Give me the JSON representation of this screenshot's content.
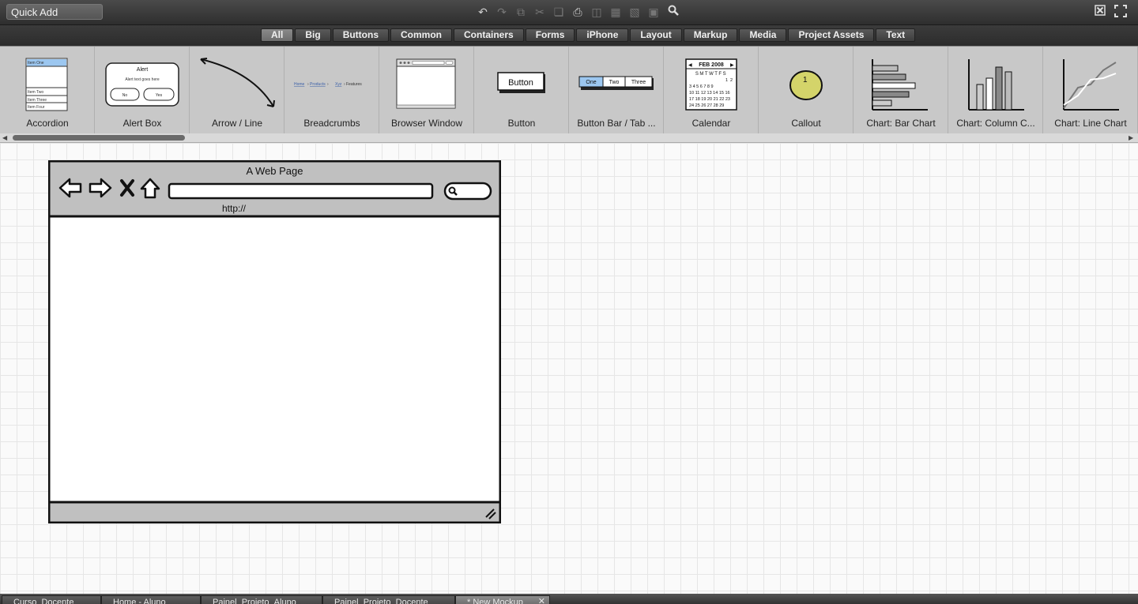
{
  "toolbar": {
    "quick_add_value": "Quick Add",
    "icons": [
      "undo-icon",
      "redo-icon",
      "duplicate-icon",
      "cut-icon",
      "copy-icon",
      "paste-icon",
      "delete-icon",
      "group-icon",
      "ungroup-icon",
      "lock-icon",
      "search-icon"
    ],
    "window_icons": [
      "close-window-icon",
      "fullscreen-icon"
    ]
  },
  "categories": [
    "All",
    "Big",
    "Buttons",
    "Common",
    "Containers",
    "Forms",
    "iPhone",
    "Layout",
    "Markup",
    "Media",
    "Project Assets",
    "Text"
  ],
  "active_category": "All",
  "library": [
    {
      "label": "Accordion",
      "items": [
        "Item One",
        "Item Two",
        "Item Three",
        "Item Four"
      ]
    },
    {
      "label": "Alert Box",
      "title": "Alert",
      "text": "Alert text goes here",
      "no": "No",
      "yes": "Yes"
    },
    {
      "label": "Arrow / Line"
    },
    {
      "label": "Breadcrumbs",
      "crumbs": [
        "Home",
        "Products",
        "Xyz",
        "Features"
      ]
    },
    {
      "label": "Browser Window"
    },
    {
      "label": "Button",
      "button_text": "Button"
    },
    {
      "label": "Button Bar / Tab ...",
      "segments": [
        "One",
        "Two",
        "Three"
      ]
    },
    {
      "label": "Calendar",
      "month": "FEB 2008",
      "days": "SMTWTFS"
    },
    {
      "label": "Callout",
      "number": "1"
    },
    {
      "label": "Chart: Bar Chart"
    },
    {
      "label": "Chart: Column C..."
    },
    {
      "label": "Chart: Line Chart"
    }
  ],
  "canvas": {
    "mock_title": "A Web Page",
    "mock_url": "http://"
  },
  "tabs": [
    {
      "label": "Curso_Docente",
      "active": false
    },
    {
      "label": "Home - Aluno",
      "active": false
    },
    {
      "label": "Painel_Projeto_Aluno",
      "active": false
    },
    {
      "label": "Painel_Projeto_Docente",
      "active": false
    },
    {
      "label": "* New Mockup",
      "active": true
    }
  ],
  "colors": {
    "toolbar": "#3a3a3a",
    "library": "#c8c8c8",
    "canvas": "#fafafa",
    "callout": "#d4d46a"
  }
}
